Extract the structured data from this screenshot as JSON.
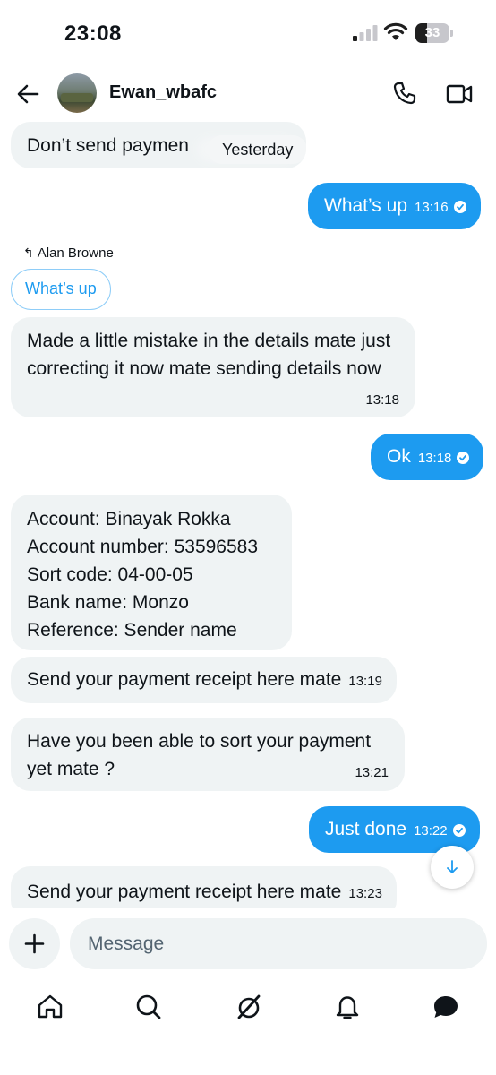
{
  "status_bar": {
    "time": "23:08",
    "battery": "33",
    "battery_level": 0.33
  },
  "header": {
    "contact_name": "Ewan_wbafc"
  },
  "messages": [
    {
      "id": "m0",
      "direction": "in",
      "text": "Don’t send paymen",
      "date_chip": "Yesterday"
    },
    {
      "id": "m1",
      "direction": "out",
      "text": "What’s up",
      "time": "13:16",
      "status": "read"
    },
    {
      "id": "m2",
      "direction": "in",
      "reply_to": {
        "author": "Alan Browne",
        "quoted_text": "What’s up"
      },
      "text": "Made a little mistake in the details mate just correcting it now mate sending details now",
      "time": "13:18"
    },
    {
      "id": "m3",
      "direction": "out",
      "text": "Ok",
      "time": "13:18",
      "status": "read"
    },
    {
      "id": "m4",
      "direction": "in",
      "lines": [
        "Account: Binayak Rokka",
        "Account number: 53596583",
        "Sort code: 04-00-05",
        "Bank name: Monzo",
        "Reference: Sender name"
      ]
    },
    {
      "id": "m5",
      "direction": "in",
      "text": "Send your payment receipt here mate",
      "time": "13:19"
    },
    {
      "id": "m6",
      "direction": "in",
      "text": "Have you been able to sort your payment yet mate ?",
      "time": "13:21"
    },
    {
      "id": "m7",
      "direction": "out",
      "text": "Just done",
      "time": "13:22",
      "status": "read"
    },
    {
      "id": "m8",
      "direction": "in",
      "text": "Send your payment receipt here mate",
      "time": "13:23"
    }
  ],
  "composer": {
    "placeholder": "Message"
  },
  "icons": {
    "back": "back-arrow-icon",
    "call": "phone-icon",
    "video": "video-camera-icon",
    "add": "plus-icon",
    "scroll": "arrow-down-icon",
    "nav": [
      "home-icon",
      "search-icon",
      "grok-icon",
      "bell-icon",
      "messages-icon"
    ]
  },
  "colors": {
    "accent": "#1d9bf0",
    "incoming_bubble": "#eff3f4",
    "text": "#0f1419"
  }
}
